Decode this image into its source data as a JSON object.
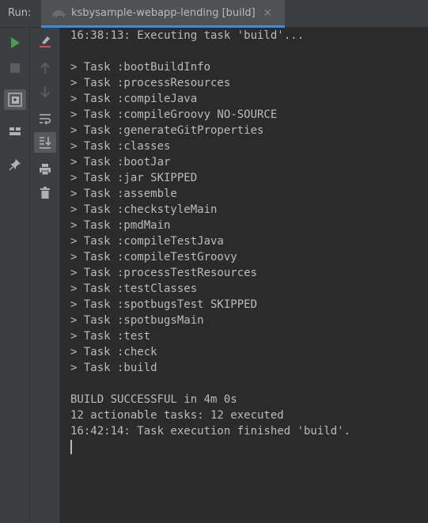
{
  "header": {
    "run_label": "Run:",
    "tab_label": "ksbysample-webapp-lending [build]",
    "close_glyph": "×"
  },
  "toolbar_left": [
    "run-icon",
    "stop-icon",
    "restore-layout-icon",
    "layout-icon",
    "pin-icon"
  ],
  "toolbar_right": [
    "clear-icon",
    "up-arrow-icon",
    "down-arrow-icon",
    "soft-wrap-icon",
    "scroll-to-end-icon",
    "print-icon",
    "trash-icon"
  ],
  "colors": {
    "run_green": "#499c54",
    "accent_blue": "#4a88c7",
    "icon_gray": "#afb1b3"
  },
  "console": {
    "lines": [
      "16:38:13: Executing task 'build'...",
      "",
      "> Task :bootBuildInfo",
      "> Task :processResources",
      "> Task :compileJava",
      "> Task :compileGroovy NO-SOURCE",
      "> Task :generateGitProperties",
      "> Task :classes",
      "> Task :bootJar",
      "> Task :jar SKIPPED",
      "> Task :assemble",
      "> Task :checkstyleMain",
      "> Task :pmdMain",
      "> Task :compileTestJava",
      "> Task :compileTestGroovy",
      "> Task :processTestResources",
      "> Task :testClasses",
      "> Task :spotbugsTest SKIPPED",
      "> Task :spotbugsMain",
      "> Task :test",
      "> Task :check",
      "> Task :build",
      "",
      "BUILD SUCCESSFUL in 4m 0s",
      "12 actionable tasks: 12 executed",
      "16:42:14: Task execution finished 'build'."
    ]
  }
}
